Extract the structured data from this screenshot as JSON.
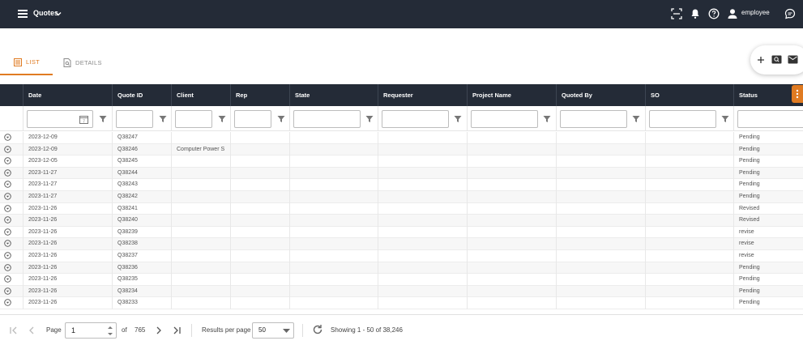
{
  "app": {
    "title": "Quotes",
    "user": "employee"
  },
  "tabs": [
    {
      "label": "LIST"
    },
    {
      "label": "DETAILS"
    }
  ],
  "columns": [
    "Date",
    "Quote ID",
    "Client",
    "Rep",
    "State",
    "Requester",
    "Project Name",
    "Quoted By",
    "SO",
    "Status"
  ],
  "filters": {
    "date_badge": "7"
  },
  "rows": [
    {
      "date": "2023-12-09",
      "quote_id": "Q38247",
      "client": "",
      "status": "Pending"
    },
    {
      "date": "2023-12-09",
      "quote_id": "Q38246",
      "client": "Computer Power S",
      "status": "Pending"
    },
    {
      "date": "2023-12-05",
      "quote_id": "Q38245",
      "client": "",
      "status": "Pending"
    },
    {
      "date": "2023-11-27",
      "quote_id": "Q38244",
      "client": "",
      "status": "Pending"
    },
    {
      "date": "2023-11-27",
      "quote_id": "Q38243",
      "client": "",
      "status": "Pending"
    },
    {
      "date": "2023-11-27",
      "quote_id": "Q38242",
      "client": "",
      "status": "Pending"
    },
    {
      "date": "2023-11-26",
      "quote_id": "Q38241",
      "client": "",
      "status": "Revised"
    },
    {
      "date": "2023-11-26",
      "quote_id": "Q38240",
      "client": "",
      "status": "Revised"
    },
    {
      "date": "2023-11-26",
      "quote_id": "Q38239",
      "client": "",
      "status": "revise"
    },
    {
      "date": "2023-11-26",
      "quote_id": "Q38238",
      "client": "",
      "status": "revise"
    },
    {
      "date": "2023-11-26",
      "quote_id": "Q38237",
      "client": "",
      "status": "revise"
    },
    {
      "date": "2023-11-26",
      "quote_id": "Q38236",
      "client": "",
      "status": "Pending"
    },
    {
      "date": "2023-11-26",
      "quote_id": "Q38235",
      "client": "",
      "status": "Pending"
    },
    {
      "date": "2023-11-26",
      "quote_id": "Q38234",
      "client": "",
      "status": "Pending"
    },
    {
      "date": "2023-11-26",
      "quote_id": "Q38233",
      "client": "",
      "status": "Pending"
    }
  ],
  "pager": {
    "page_label": "Page",
    "page_value": "1",
    "of_label": "of",
    "total_pages": "765",
    "rpp_label": "Results per page",
    "rpp_value": "50",
    "showing": "Showing 1 - 50 of 38,246"
  }
}
